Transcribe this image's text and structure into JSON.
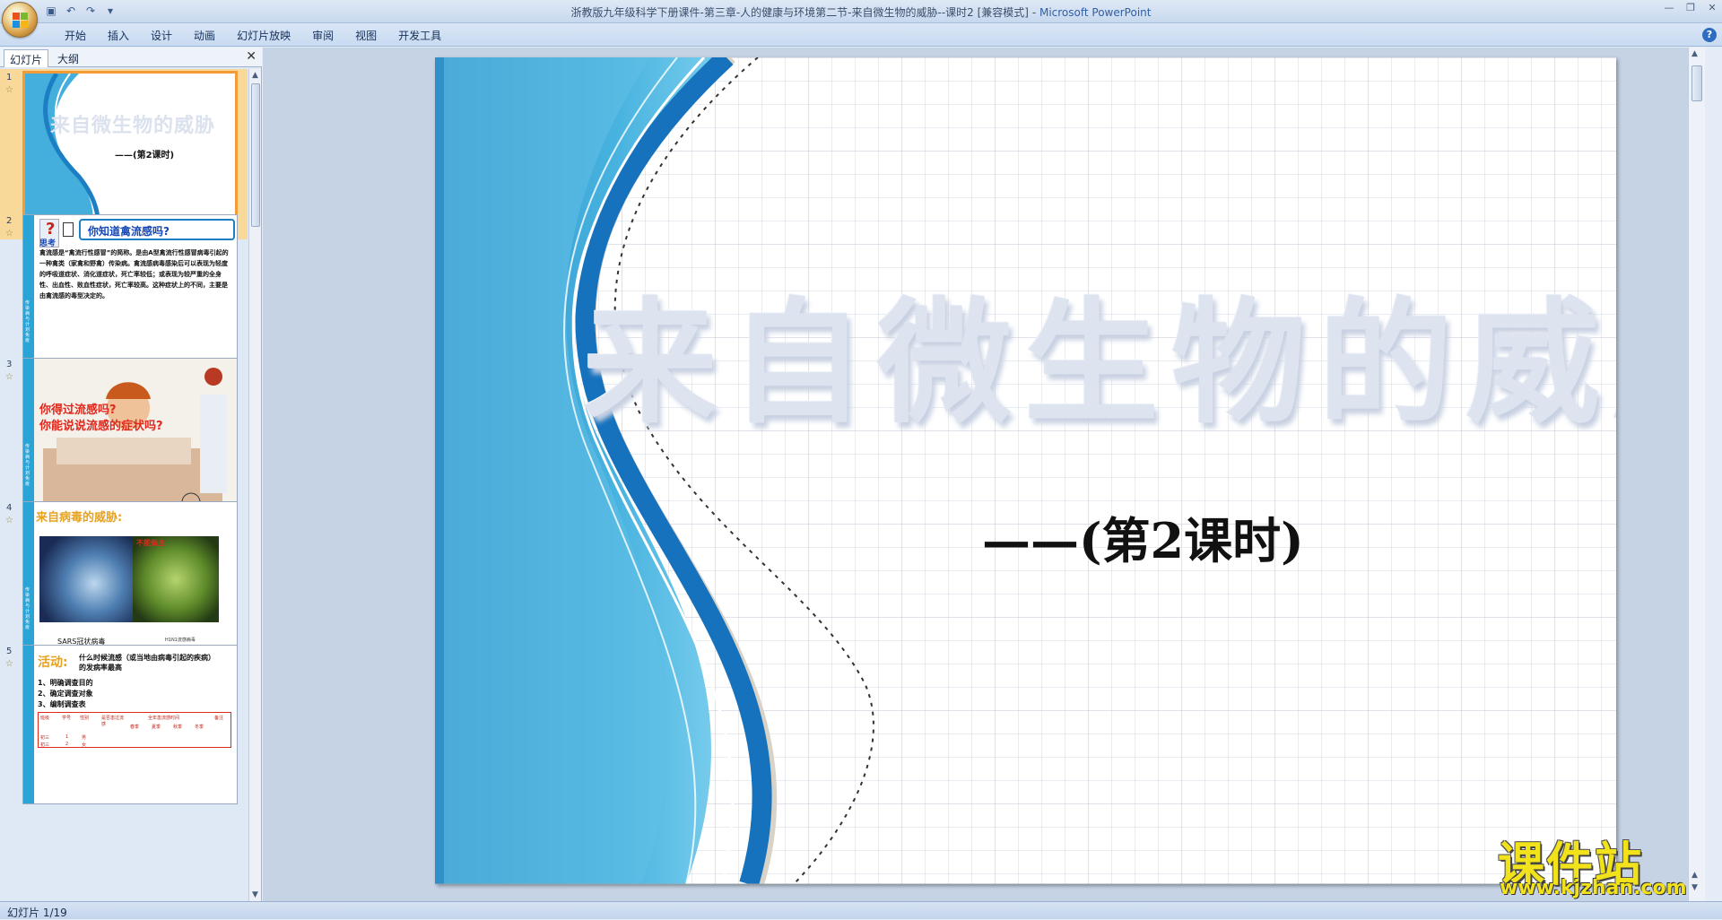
{
  "window": {
    "title": "浙教版九年级科学下册课件-第三章-人的健康与环境第二节-来自微生物的威胁--课时2 [兼容模式]",
    "app_name": "Microsoft PowerPoint"
  },
  "ribbon": {
    "tabs": [
      "开始",
      "插入",
      "设计",
      "动画",
      "幻灯片放映",
      "审阅",
      "视图",
      "开发工具"
    ]
  },
  "left_pane": {
    "tab_slides": "幻灯片",
    "tab_outline": "大纲",
    "close": "✕",
    "slides": [
      {
        "num": "1",
        "title": "来自微生物的威胁",
        "subtitle": "——(第2课时)"
      },
      {
        "num": "2",
        "tag": "思考",
        "title": "你知道禽流感吗?",
        "body": "禽流感是“禽流行性感冒”的简称。是由A型禽流行性感冒病毒引起的一种禽类（家禽和野禽）传染病。禽流感病毒感染后可以表现为轻度的呼吸道症状、消化道症状，死亡率较低；或表现为较严重的全身性、出血性、败血性症状，死亡率较高。这种症状上的不同，主要是由禽流感的毒型决定的。",
        "side": "传染病与计划免疫"
      },
      {
        "num": "3",
        "line1": "你得过流感吗?",
        "line2": "你能说说流感的症状吗?",
        "side": "传染病与计划免疫"
      },
      {
        "num": "4",
        "title": "来自病毒的威胁:",
        "caption_left": "SARS冠状病毒",
        "caption_right": "H1N1流感病毒",
        "label_right": "不能做主",
        "side": "传染病与计划免疫"
      },
      {
        "num": "5",
        "title_prefix": "活动:",
        "title": "什么时候流感（或当地由病毒引起的疾病）的发病率最高",
        "steps": [
          "1、明确调查目的",
          "2、确定调查对象",
          "3、编制调查表"
        ],
        "table_headers": [
          "班级",
          "学号",
          "性别",
          "是否患过流感",
          "全年患流感时间",
          "备注"
        ],
        "season_headers": [
          "春季",
          "夏季",
          "秋季",
          "冬季"
        ],
        "rows": [
          [
            "初三",
            "1",
            "男"
          ],
          [
            "初三",
            "2",
            "女"
          ]
        ]
      }
    ]
  },
  "slide": {
    "title": "来自微生物的威胁",
    "subtitle": "——(第2课时)"
  },
  "status": {
    "text": "幻灯片 1/19"
  },
  "watermark": {
    "text": "课件站",
    "url": "www.kjzhan.com"
  },
  "colors": {
    "accent_blue": "#1c7ec3",
    "selected_orange": "#f29b37",
    "watermark_yellow": "#f2e21b"
  }
}
